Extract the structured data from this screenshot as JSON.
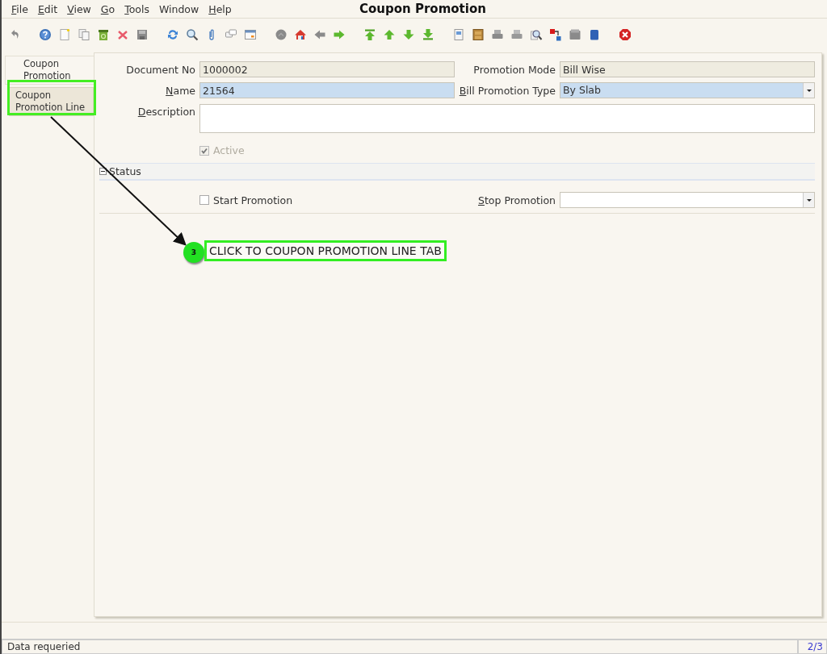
{
  "menu": [
    {
      "label": "File",
      "mnemonic": true
    },
    {
      "label": "Edit",
      "mnemonic": true
    },
    {
      "label": "View",
      "mnemonic": true
    },
    {
      "label": "Go",
      "mnemonic": true
    },
    {
      "label": "Tools",
      "mnemonic": true
    },
    {
      "label": "Window",
      "mnemonic": false
    },
    {
      "label": "Help",
      "mnemonic": true
    }
  ],
  "window": {
    "title": "Coupon Promotion"
  },
  "tabs": [
    {
      "label": "Coupon Promotion",
      "selected": true
    },
    {
      "label": "Coupon Promotion Line",
      "selected": false
    }
  ],
  "form": {
    "document_no": {
      "label": "Document No",
      "value": "1000002",
      "mnemonic": false,
      "readonly": true
    },
    "promotion_mode": {
      "label": "Promotion Mode",
      "value": "Bill Wise",
      "mnemonic": false,
      "readonly": true
    },
    "name": {
      "label": "Name",
      "value": "21564",
      "mnemonic": true,
      "readonly": false,
      "mandatory": true
    },
    "bill_promotion_type": {
      "label": "Bill Promotion Type",
      "value": "By Slab",
      "mnemonic": true,
      "readonly": false,
      "mandatory": true
    },
    "description": {
      "label": "Description",
      "mnemonic": true,
      "readonly": false,
      "mandatory": false
    },
    "active": {
      "label": "Active",
      "checked": true,
      "disabled": true
    }
  },
  "status_section": {
    "title": "Status",
    "expanded": true,
    "start_promotion": {
      "label": "Start Promotion",
      "checked": false,
      "disabled": false
    },
    "stop_promotion": {
      "label": "Stop Promotion",
      "mnemonic": true,
      "readonly": false,
      "mandatory": false
    }
  },
  "annotation": {
    "step": "3",
    "text": "CLICK TO COUPON PROMOTION LINE TAB"
  },
  "status_bar": {
    "message": "Data requeried",
    "record": "2/3"
  }
}
